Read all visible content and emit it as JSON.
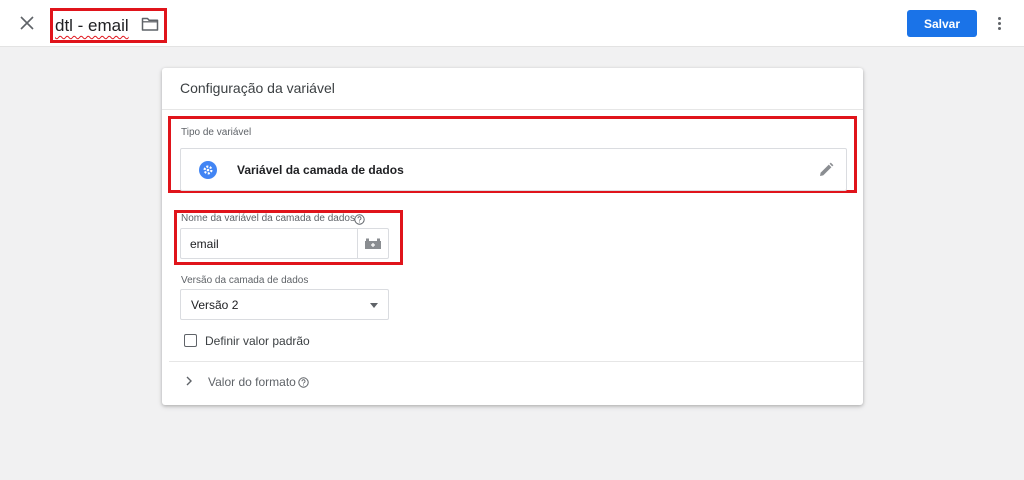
{
  "header": {
    "close_icon": "close-icon",
    "title": "dtl - email",
    "folder_icon": "folder-icon",
    "save_label": "Salvar",
    "more_icon": "more-vert-icon",
    "accent": "#1a73e8",
    "highlight": "#e0141b"
  },
  "card": {
    "title": "Configuração da variável",
    "variable_type": {
      "label": "Tipo de variável",
      "name": "Variável da camada de dados",
      "icon": "gear-icon",
      "edit_icon": "pencil-icon"
    },
    "datalayer_name": {
      "label": "Nome da variável da camada de dados",
      "help_icon": "help-icon",
      "value": "email",
      "picker_icon": "variable-picker-icon"
    },
    "version": {
      "label": "Versão da camada de dados",
      "selected": "Versão 2"
    },
    "default_value": {
      "label": "Definir valor padrão",
      "checked": false
    },
    "format_value": {
      "label": "Valor do formato",
      "help_icon": "help-icon"
    }
  }
}
